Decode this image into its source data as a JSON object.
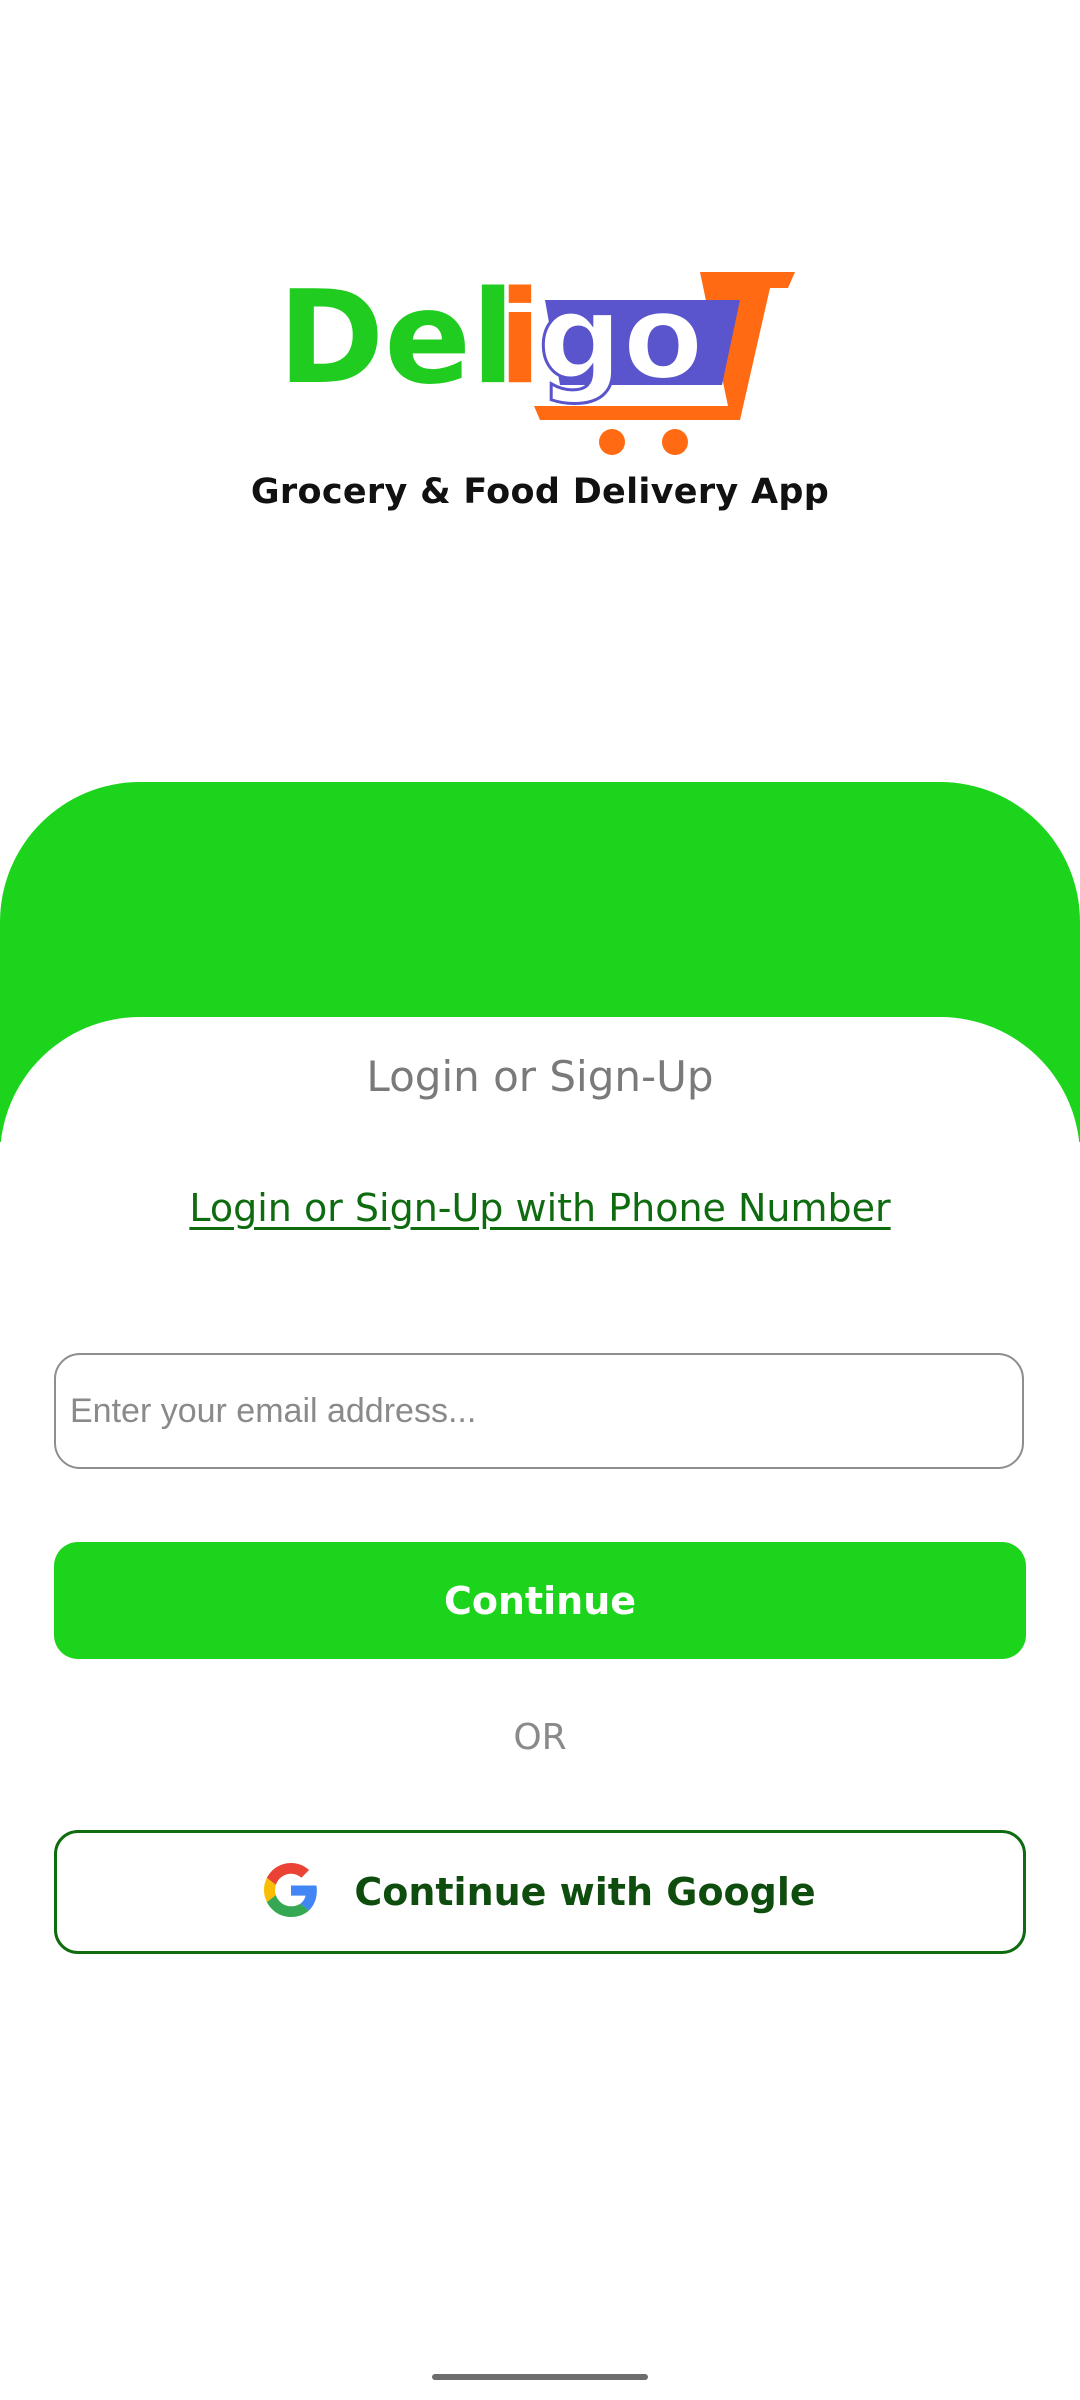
{
  "app": {
    "logo_text": "Deligo",
    "tagline": "Grocery & Food Delivery App"
  },
  "login": {
    "heading": "Login or Sign-Up",
    "phone_link": "Login or Sign-Up with Phone Number",
    "email_placeholder": "Enter your email address...",
    "email_value": "",
    "continue_label": "Continue",
    "or_label": "OR",
    "google_label": "Continue with Google"
  },
  "icons": {
    "logo": "deligo-cart-logo",
    "google": "google-g-icon"
  },
  "colors": {
    "brand_green": "#1bd41b",
    "link_green": "#0f6b0f",
    "logo_orange": "#ff6a13",
    "logo_purple": "#5a55cc"
  }
}
